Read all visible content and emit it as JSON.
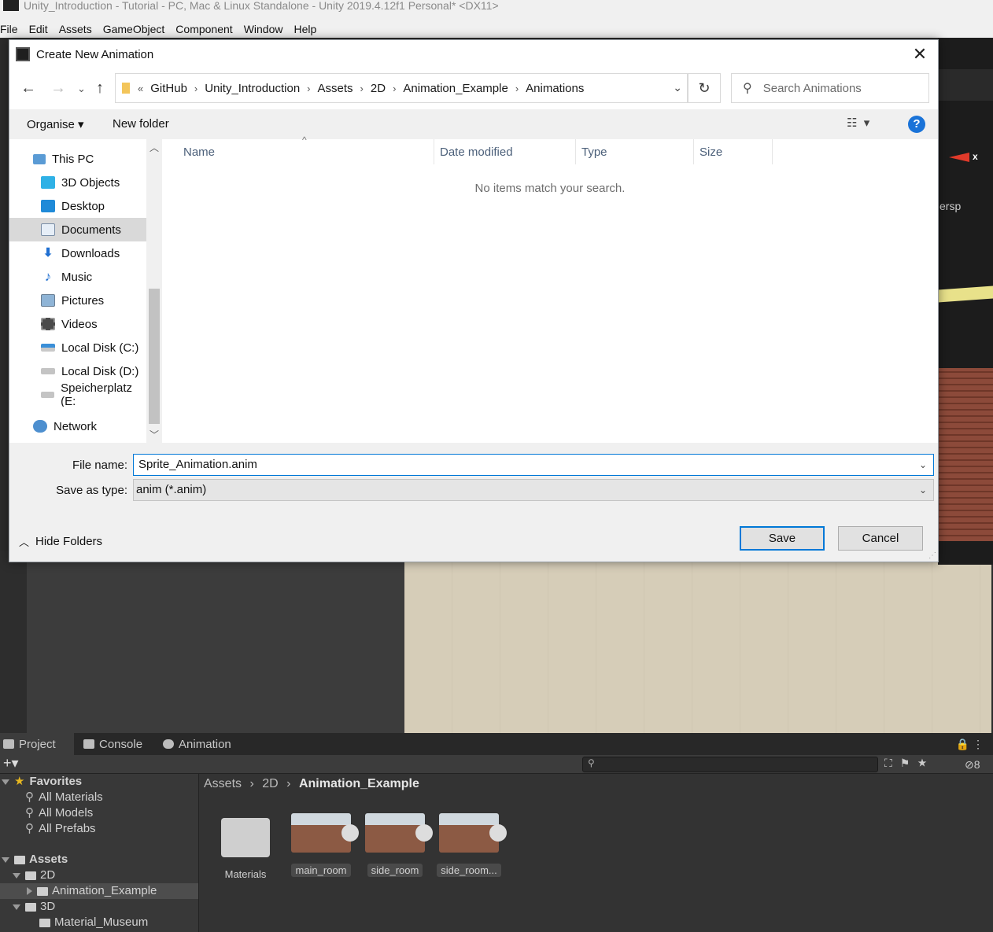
{
  "unity": {
    "title": "Unity_Introduction - Tutorial - PC, Mac & Linux Standalone - Unity 2019.4.12f1 Personal* <DX11>",
    "menu": [
      "File",
      "Edit",
      "Assets",
      "GameObject",
      "Component",
      "Window",
      "Help"
    ],
    "scene_persp_label": "ersp",
    "gizmo_x": "x",
    "bottom_tabs": [
      "Project",
      "Console",
      "Animation"
    ],
    "hidden_count": "8",
    "favorites": {
      "label": "Favorites",
      "items": [
        "All Materials",
        "All Models",
        "All Prefabs"
      ]
    },
    "tree": {
      "assets": "Assets",
      "d2": "2D",
      "animation_example": "Animation_Example",
      "d3": "3D",
      "material_museum": "Material_Museum"
    },
    "breadcrumb": [
      "Assets",
      "2D",
      "Animation_Example"
    ],
    "assets": [
      "Materials",
      "main_room",
      "side_room",
      "side_room..."
    ]
  },
  "dialog": {
    "title": "Create New Animation",
    "address": [
      "GitHub",
      "Unity_Introduction",
      "Assets",
      "2D",
      "Animation_Example",
      "Animations"
    ],
    "address_prefix": "«",
    "search_placeholder": "Search Animations",
    "organise": "Organise ▾",
    "new_folder": "New folder",
    "nav": {
      "this_pc": "This PC",
      "items": [
        "3D Objects",
        "Desktop",
        "Documents",
        "Downloads",
        "Music",
        "Pictures",
        "Videos",
        "Local Disk (C:)",
        "Local Disk (D:)",
        "Speicherplatz (E:"
      ],
      "network": "Network"
    },
    "columns": [
      "Name",
      "Date modified",
      "Type",
      "Size"
    ],
    "empty_message": "No items match your search.",
    "file_name_label": "File name:",
    "file_name": "Sprite_Animation.anim",
    "save_type_label": "Save as type:",
    "save_type": "anim (*.anim)",
    "hide_folders": "Hide Folders",
    "save": "Save",
    "cancel": "Cancel"
  },
  "colors": {
    "accent": "#0078d7",
    "help": "#1a73d8",
    "unity_dark": "#383838"
  }
}
